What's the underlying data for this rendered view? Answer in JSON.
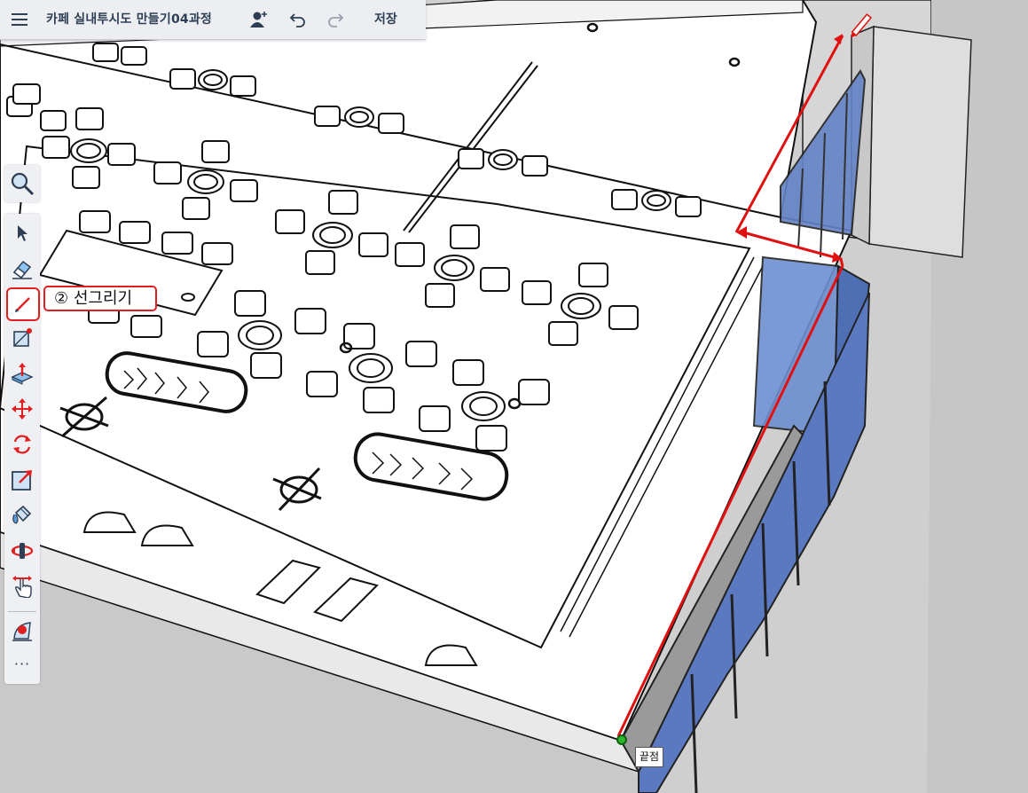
{
  "app": {
    "title": "카페 실내투시도 만들기04과정",
    "save_label": "저장",
    "icons": [
      "menu-icon",
      "add-user-icon",
      "undo-icon",
      "redo-icon"
    ]
  },
  "toolbar": {
    "search_icon": "search-icon",
    "tools": [
      "select-icon",
      "eraser-icon",
      "pencil-icon",
      "shape-icon",
      "push-pull-icon",
      "move-icon",
      "rotate-icon",
      "scale-icon",
      "paint-bucket-icon",
      "orbit-icon",
      "pan-icon",
      "section-plane-icon"
    ],
    "active_tool": "pencil-icon",
    "more_label": "···"
  },
  "callout": {
    "text": "② 선그리기"
  },
  "inference_tooltip": {
    "text": "끝점"
  },
  "colors": {
    "accent": "#e02020",
    "toolbar_bg": "#eef0f3",
    "ui_text": "#2d3e55",
    "glass": "#5d7fc4"
  }
}
